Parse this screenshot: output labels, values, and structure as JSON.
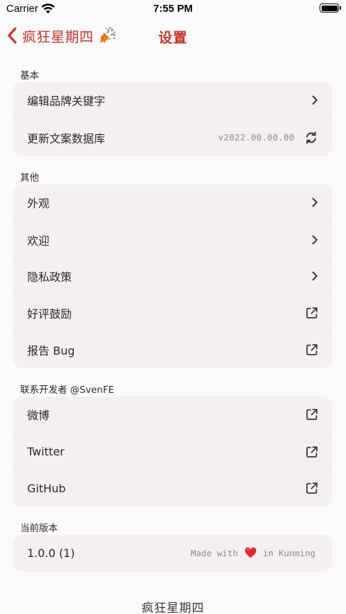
{
  "status_bar": {
    "carrier": "Carrier",
    "time": "7:55 PM"
  },
  "nav": {
    "back_label": "疯狂星期四",
    "title": "设置"
  },
  "sections": [
    {
      "header": "基本",
      "rows": [
        {
          "label": "编辑品牌关键字",
          "accessory": "chevron"
        },
        {
          "label": "更新文案数据库",
          "value": "v2022.00.00.00",
          "accessory": "sync-icon"
        }
      ]
    },
    {
      "header": "其他",
      "rows": [
        {
          "label": "外观",
          "accessory": "chevron"
        },
        {
          "label": "欢迎",
          "accessory": "chevron"
        },
        {
          "label": "隐私政策",
          "accessory": "chevron"
        },
        {
          "label": "好评鼓励",
          "accessory": "external-link-icon"
        },
        {
          "label": "报告 Bug",
          "accessory": "external-link-icon"
        }
      ]
    },
    {
      "header": "联系开发者 @SvenFE",
      "rows": [
        {
          "label": "微博",
          "accessory": "external-link-icon"
        },
        {
          "label": "Twitter",
          "accessory": "external-link-icon"
        },
        {
          "label": "GitHub",
          "accessory": "external-link-icon"
        }
      ]
    },
    {
      "header": "当前版本",
      "rows": [
        {
          "label": "1.0.0 (1)",
          "made_with_prefix": "Made with",
          "made_with_suffix": "in Kunming"
        }
      ]
    }
  ],
  "footer": "疯狂星期四",
  "colors": {
    "accent": "#c8342d",
    "background": "#fdfafb",
    "group_bg": "#f4f0f1"
  }
}
